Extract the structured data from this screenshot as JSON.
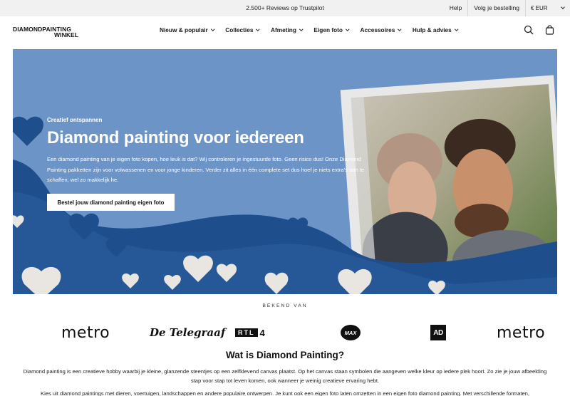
{
  "topbar": {
    "reviews": "2.500+ Reviews op Trustpilot",
    "help": "Help",
    "track_order": "Volg je bestelling",
    "currency": "€ EUR"
  },
  "header": {
    "logo_line1": "DIAMONDPAINTING",
    "logo_line2": "WINKEL",
    "nav": [
      {
        "label": "Nieuw & populair"
      },
      {
        "label": "Collecties"
      },
      {
        "label": "Afmeting"
      },
      {
        "label": "Eigen foto"
      },
      {
        "label": "Accessoires"
      },
      {
        "label": "Hulp & advies"
      }
    ],
    "icons": [
      "search-icon",
      "cart-icon"
    ]
  },
  "hero": {
    "eyebrow": "Creatief ontspannen",
    "title": "Diamond painting voor iedereen",
    "body": "Een diamond painting van je eigen foto kopen, hoe leuk is dat? Wij controleren je ingestuurde foto. Geen risico dus! Onze Diamond Painting pakketten zijn voor volwassenen en voor jonge kinderen. Verder zit alles in één complete set dus hoef je niets extra's aan te schaffen, wel zo makkelijk he.",
    "cta": "Bestel jouw diamond painting eigen foto",
    "colors": {
      "background": "#6d94c7",
      "wave": "#1f4e8c",
      "heart": "#e9e6e2"
    }
  },
  "known": {
    "label": "BEKEND VAN",
    "logos": {
      "metro1": "metro",
      "telegraaf": "De Telegraaf",
      "rtl": "RTL",
      "rtl_num": "4",
      "max": "MAX",
      "ad": "AD",
      "metro2": "metro"
    }
  },
  "about": {
    "title": "Wat is Diamond Painting?",
    "p1": "Diamond painting is een creatieve hobby waarbij je kleine, glanzende steentjes op een zelfklevend canvas plaatst. Op het canvas staan symbolen die aangeven welke kleur op iedere plek hoort. Zo zie je jouw afbeelding stap voor stap tot leven komen, ook wanneer je weinig creatieve ervaring hebt.",
    "p2": "Kies uit diamond paintings met dieren, voertuigen, landschappen en andere populaire ontwerpen. Je kunt ook een eigen foto laten omzetten in een eigen foto diamond painting. Met verschillende formaten,"
  }
}
